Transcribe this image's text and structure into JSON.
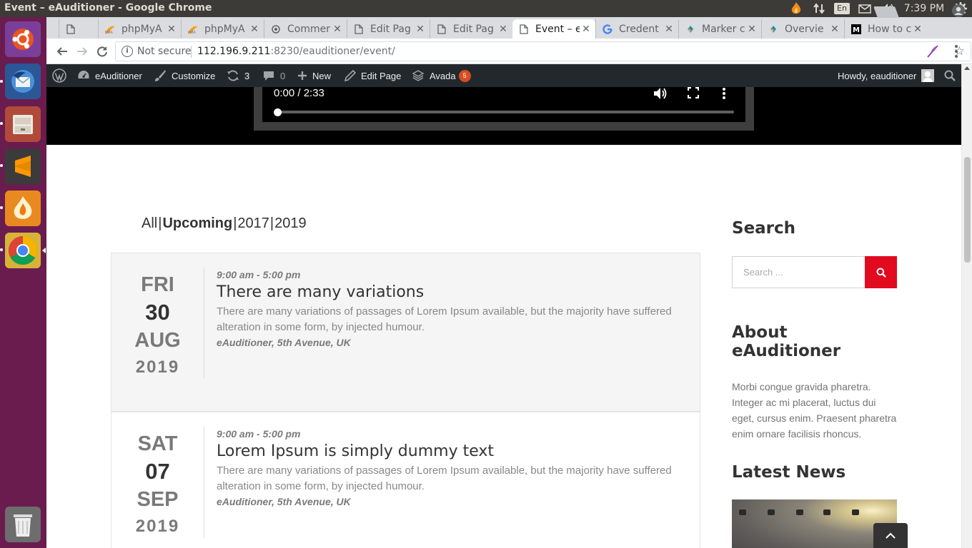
{
  "os_panel": {
    "window_title": "Event – eAuditioner - Google Chrome",
    "lang": "En",
    "clock": "7:39 PM"
  },
  "launcher": {
    "items": [
      "ubuntu-dash",
      "thunderbird-mail",
      "file-manager",
      "sublime-text",
      "app-flame",
      "google-chrome",
      "trash"
    ]
  },
  "browser": {
    "tabs": [
      {
        "label": "",
        "icon": "page-icon"
      },
      {
        "label": "phpMyA",
        "icon": "phpmyadmin-icon"
      },
      {
        "label": "phpMyA",
        "icon": "phpmyadmin-icon"
      },
      {
        "label": "Commer",
        "icon": "bug-icon"
      },
      {
        "label": "Edit Pag",
        "icon": "page-icon"
      },
      {
        "label": "Edit Pag",
        "icon": "page-icon"
      },
      {
        "label": "Event – e",
        "icon": "page-icon",
        "active": true
      },
      {
        "label": "Credent",
        "icon": "google-icon"
      },
      {
        "label": "Marker c",
        "icon": "maps-icon"
      },
      {
        "label": "Overvie",
        "icon": "maps-icon"
      },
      {
        "label": "How to c",
        "icon": "medium-icon"
      }
    ],
    "omnibox": {
      "security": "Not secure",
      "url_host": "112.196.9.211",
      "url_rest": ":8230/eauditioner/event/"
    }
  },
  "adminbar": {
    "site_name": "eAuditioner",
    "customize": "Customize",
    "updates_count": "3",
    "comments_count": "0",
    "new_label": "New",
    "edit_page": "Edit Page",
    "avada_label": "Avada",
    "avada_badge": "5",
    "howdy": "Howdy, eauditioner"
  },
  "video": {
    "time": "0:00 / 2:33",
    "progress": 0
  },
  "filters": {
    "all": "All",
    "upcoming": "Upcoming",
    "y2017": "2017",
    "y2019": "2019",
    "sep": "|",
    "active": "Upcoming"
  },
  "events": [
    {
      "dow": "FRI",
      "day": "30",
      "month": "AUG",
      "year": "2019",
      "time": "9:00 am - 5:00 pm",
      "title": "There are many variations",
      "desc": "There are many variations of passages of Lorem Ipsum available, but the majority have suffered alteration in some form, by injected humour.",
      "venue": "eAuditioner, 5th Avenue, UK"
    },
    {
      "dow": "SAT",
      "day": "07",
      "month": "SEP",
      "year": "2019",
      "time": "9:00 am - 5:00 pm",
      "title": "Lorem Ipsum is simply dummy text",
      "desc": "There are many variations of passages of Lorem Ipsum available, but the majority have suffered alteration in some form, by injected humour.",
      "venue": "eAuditioner, 5th Avenue, UK"
    }
  ],
  "sidebar": {
    "search_title": "Search",
    "search_placeholder": "Search ...",
    "about_title": "About eAuditioner",
    "about_text": "Morbi congue gravida pharetra. Integer ac mi placerat, luctus dui eget, cursus enim. Praesent pharetra enim ornare facilisis rhoncus.",
    "news_title": "Latest News"
  },
  "colors": {
    "accent_red": "#e10a1e",
    "adminbar_bg": "#23282d",
    "launcher_bg": "#6b1c4f"
  }
}
